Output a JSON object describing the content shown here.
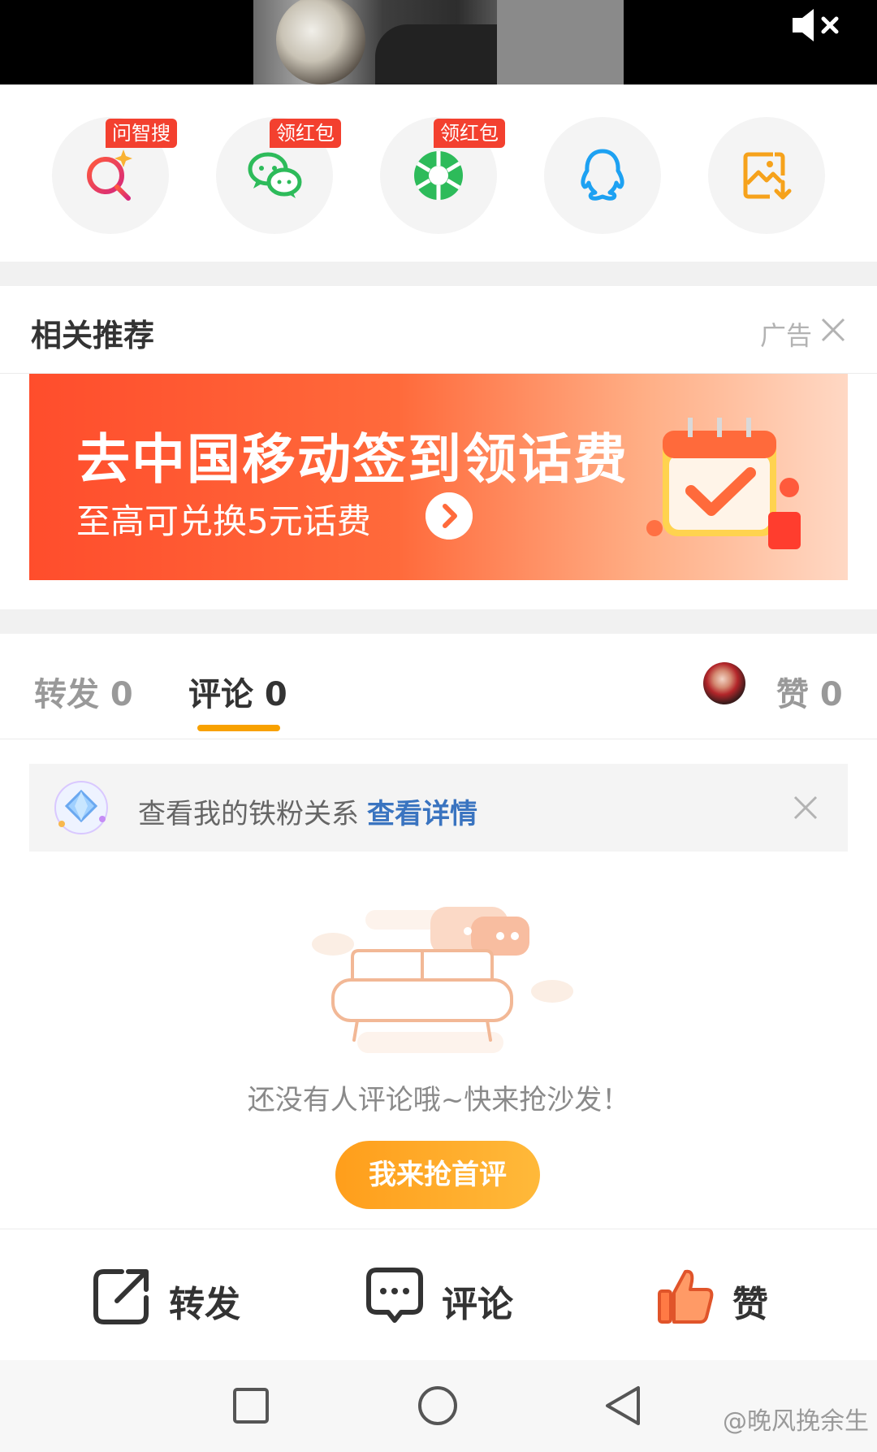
{
  "share": {
    "items": [
      {
        "icon": "ai-search-icon",
        "badge": "问智搜"
      },
      {
        "icon": "wechat-icon",
        "badge": "领红包"
      },
      {
        "icon": "moments-icon",
        "badge": "领红包"
      },
      {
        "icon": "qq-icon",
        "badge": ""
      },
      {
        "icon": "save-image-icon",
        "badge": ""
      }
    ]
  },
  "related": {
    "title": "相关推荐",
    "ad_label": "广告"
  },
  "banner": {
    "main": "去中国移动签到领话费",
    "sub": "至高可兑换5元话费"
  },
  "tabs": {
    "repost": "转发 0",
    "comment": "评论 0",
    "like": "赞 0"
  },
  "fan_bar": {
    "text": "查看我的铁粉关系",
    "link": "查看详情"
  },
  "empty": {
    "text": "还没有人评论哦~快来抢沙发！",
    "button": "我来抢首评"
  },
  "actions": {
    "repost": "转发",
    "comment": "评论",
    "like": "赞"
  },
  "watermark": "@晚风挽余生",
  "colors": {
    "accent": "#f8a100",
    "badge": "#f3402f",
    "link": "#3a74c0",
    "banner": "#ff4d2c"
  }
}
